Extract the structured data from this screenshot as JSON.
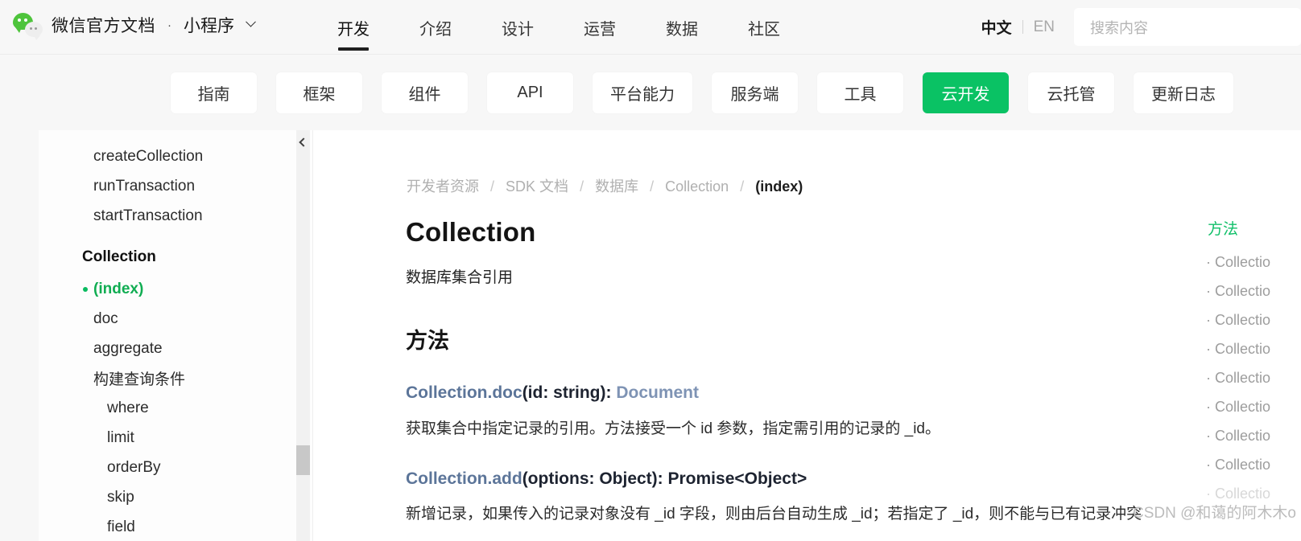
{
  "header": {
    "logo_icon": "wechat-logo-icon",
    "brand_title": "微信官方文档",
    "brand_separator": "·",
    "brand_sub": "小程序",
    "brand_caret_icon": "chevron-down-icon",
    "nav": [
      {
        "label": "开发",
        "active": true
      },
      {
        "label": "介绍",
        "active": false
      },
      {
        "label": "设计",
        "active": false
      },
      {
        "label": "运营",
        "active": false
      },
      {
        "label": "数据",
        "active": false
      },
      {
        "label": "社区",
        "active": false
      }
    ],
    "lang": {
      "zh": "中文",
      "en": "EN"
    },
    "search": {
      "placeholder": "搜索内容",
      "value": ""
    }
  },
  "tabs": [
    {
      "label": "指南",
      "active": false
    },
    {
      "label": "框架",
      "active": false
    },
    {
      "label": "组件",
      "active": false
    },
    {
      "label": "API",
      "active": false
    },
    {
      "label": "平台能力",
      "active": false
    },
    {
      "label": "服务端",
      "active": false
    },
    {
      "label": "工具",
      "active": false
    },
    {
      "label": "云开发",
      "active": true
    },
    {
      "label": "云托管",
      "active": false
    },
    {
      "label": "更新日志",
      "active": false
    }
  ],
  "sidebar": {
    "items": [
      {
        "label": "createCollection",
        "level": 1,
        "state": "normal"
      },
      {
        "label": "runTransaction",
        "level": 1,
        "state": "normal"
      },
      {
        "label": "startTransaction",
        "level": 1,
        "state": "normal"
      },
      {
        "label": "Collection",
        "level": 0,
        "state": "group"
      },
      {
        "label": "(index)",
        "level": 1,
        "state": "current"
      },
      {
        "label": "doc",
        "level": 1,
        "state": "normal"
      },
      {
        "label": "aggregate",
        "level": 1,
        "state": "normal"
      },
      {
        "label": "构建查询条件",
        "level": 1,
        "state": "normal"
      },
      {
        "label": "where",
        "level": 2,
        "state": "normal"
      },
      {
        "label": "limit",
        "level": 2,
        "state": "normal"
      },
      {
        "label": "orderBy",
        "level": 2,
        "state": "normal"
      },
      {
        "label": "skip",
        "level": 2,
        "state": "normal"
      },
      {
        "label": "field",
        "level": 2,
        "state": "normal"
      }
    ],
    "scrollbar": {
      "up_arrow_icon": "chevron-up-icon"
    }
  },
  "content": {
    "breadcrumb": [
      {
        "label": "开发者资源",
        "last": false
      },
      {
        "label": "SDK 文档",
        "last": false
      },
      {
        "label": "数据库",
        "last": false
      },
      {
        "label": "Collection",
        "last": false
      },
      {
        "label": "(index)",
        "last": true
      }
    ],
    "breadcrumb_separator": "/",
    "title": "Collection",
    "intro": "数据库集合引用",
    "section_heading": "方法",
    "methods": [
      {
        "name": "Collection.doc",
        "params": "(id: string): ",
        "returns": "Document",
        "description": "获取集合中指定记录的引用。方法接受一个 id 参数，指定需引用的记录的 _id。"
      },
      {
        "name": "Collection.add",
        "params": "(options: Object): Promise<Object>",
        "returns": "",
        "description": "新增记录，如果传入的记录对象没有 _id 字段，则由后台自动生成 _id；若指定了 _id，则不能与已有记录冲突"
      }
    ]
  },
  "toc": {
    "title": "方法",
    "items": [
      {
        "label": "· Collectio",
        "faded": false
      },
      {
        "label": "· Collectio",
        "faded": false
      },
      {
        "label": "· Collectio",
        "faded": false
      },
      {
        "label": "· Collectio",
        "faded": false
      },
      {
        "label": "· Collectio",
        "faded": false
      },
      {
        "label": "· Collectio",
        "faded": false
      },
      {
        "label": "· Collectio",
        "faded": false
      },
      {
        "label": "· Collectio",
        "faded": false
      },
      {
        "label": "· Collectio",
        "faded": true
      }
    ]
  },
  "watermark": "CSDN @和蔼的阿木木o",
  "colors": {
    "accent_green": "#0ac264",
    "current_green": "#10ad52",
    "toc_green": "#12c06a",
    "signature_blue": "#5c7599",
    "signature_blue_light": "#7e93b4",
    "page_bg": "#f7f7f7",
    "content_bg": "#ffffff"
  }
}
